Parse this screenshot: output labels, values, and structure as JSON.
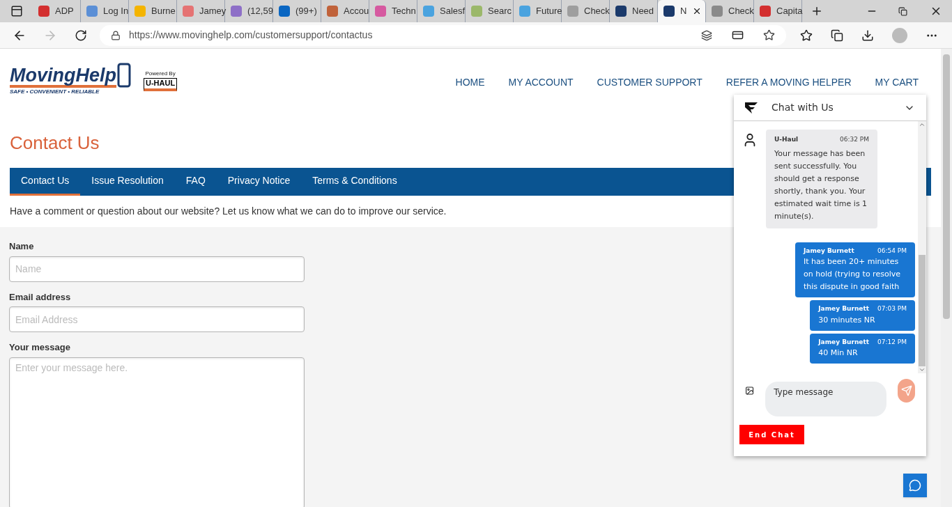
{
  "browser": {
    "tabs": [
      {
        "title": "ADP",
        "selected": false,
        "color": "#d32f2f"
      },
      {
        "title": "Log In",
        "selected": false,
        "color": "#5b8fd6"
      },
      {
        "title": "Burne",
        "selected": false,
        "color": "#f4b400"
      },
      {
        "title": "Jamey",
        "selected": false,
        "color": "#e57373"
      },
      {
        "title": "(12,59",
        "selected": false,
        "color": "#8e6fc7"
      },
      {
        "title": "(99+)",
        "selected": false,
        "color": "#0a66c2"
      },
      {
        "title": "Accou",
        "selected": false,
        "color": "#c0623a"
      },
      {
        "title": "Techn",
        "selected": false,
        "color": "#d65aa0"
      },
      {
        "title": "Salesf",
        "selected": false,
        "color": "#4aa3df"
      },
      {
        "title": "Searc",
        "selected": false,
        "color": "#9bb86a"
      },
      {
        "title": "Future",
        "selected": false,
        "color": "#4aa3df"
      },
      {
        "title": "Check",
        "selected": false,
        "color": "#9e9e9e"
      },
      {
        "title": "Need",
        "selected": false,
        "color": "#1b3a6b"
      },
      {
        "title": "N",
        "selected": true,
        "color": "#1b3a6b"
      },
      {
        "title": "Check",
        "selected": false,
        "color": "#8a8a8a"
      },
      {
        "title": "Capita",
        "selected": false,
        "color": "#d32f2f"
      }
    ],
    "url": "https://www.movinghelp.com/customersupport/contactus"
  },
  "header": {
    "logo": {
      "name": "MovingHelp",
      "tagline": "SAFE • CONVENIENT • RELIABLE",
      "powered_by": "Powered By",
      "partner": "U-HAUL"
    },
    "nav": [
      "HOME",
      "MY ACCOUNT",
      "CUSTOMER SUPPORT",
      "REFER A MOVING HELPER",
      "MY CART"
    ]
  },
  "page": {
    "title": "Contact Us",
    "tabs": [
      {
        "label": "Contact Us",
        "selected": true
      },
      {
        "label": "Issue Resolution",
        "selected": false
      },
      {
        "label": "FAQ",
        "selected": false
      },
      {
        "label": "Privacy Notice",
        "selected": false
      },
      {
        "label": "Terms & Conditions",
        "selected": false
      }
    ],
    "intro": "Have a comment or question about our website? Let us know what we can do to improve our service.",
    "form": [
      {
        "kind": "input",
        "label": "Name",
        "placeholder": "Name"
      },
      {
        "kind": "input",
        "label": "Email address",
        "placeholder": "Email Address"
      },
      {
        "kind": "textarea",
        "label": "Your message",
        "placeholder": "Enter your message here."
      }
    ]
  },
  "chat": {
    "title": "Chat with Us",
    "messages": [
      {
        "kind": "agent",
        "sender": "U-Haul",
        "time": "06:32 PM",
        "text": "Your message has been sent successfully. You should get a response shortly, thank you. Your estimated wait time is 1 minute(s)."
      },
      {
        "kind": "user",
        "sender": "Jamey Burnett",
        "time": "06:54 PM",
        "text": "It has been 20+ minutes on hold (trying to resolve this dispute in good faith"
      },
      {
        "kind": "user",
        "sender": "Jamey Burnett",
        "time": "07:03 PM",
        "text": "30 minutes NR"
      },
      {
        "kind": "user",
        "sender": "Jamey Burnett",
        "time": "07:12 PM",
        "text": "40 Min NR"
      }
    ],
    "input": {
      "placeholder": "Type message"
    },
    "end_button": "End Chat"
  }
}
